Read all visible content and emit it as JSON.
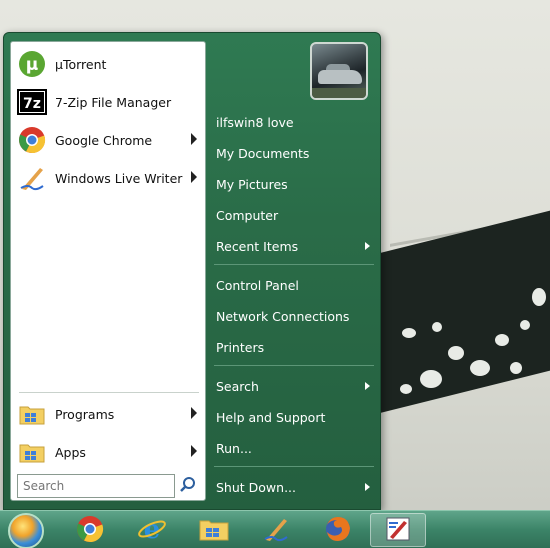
{
  "pinned": [
    {
      "label": "µTorrent",
      "icon": "utorrent-icon",
      "arrow": false
    },
    {
      "label": "7-Zip File Manager",
      "icon": "7zip-icon",
      "arrow": false
    },
    {
      "label": "Google Chrome",
      "icon": "chrome-icon",
      "arrow": true
    },
    {
      "label": "Windows Live Writer",
      "icon": "live-writer-icon",
      "arrow": true
    }
  ],
  "bottom_left": [
    {
      "label": "Programs",
      "icon": "programs-folder-icon",
      "arrow": true
    },
    {
      "label": "Apps",
      "icon": "apps-folder-icon",
      "arrow": true
    }
  ],
  "search": {
    "placeholder": "Search"
  },
  "right_items": [
    {
      "label": "ilfswin8 love",
      "arrow": false
    },
    {
      "label": "My Documents",
      "arrow": false
    },
    {
      "label": "My Pictures",
      "arrow": false
    },
    {
      "label": "Computer",
      "arrow": false
    },
    {
      "label": "Recent Items",
      "arrow": true
    },
    {
      "label": "Control Panel",
      "arrow": false
    },
    {
      "label": "Network Connections",
      "arrow": false
    },
    {
      "label": "Printers",
      "arrow": false
    },
    {
      "label": "Search",
      "arrow": true
    },
    {
      "label": "Help and Support",
      "arrow": false
    },
    {
      "label": "Run...",
      "arrow": false
    },
    {
      "label": "Shut Down...",
      "arrow": true
    }
  ],
  "taskbar": [
    {
      "icon": "chrome-icon"
    },
    {
      "icon": "internet-explorer-icon"
    },
    {
      "icon": "file-explorer-icon"
    },
    {
      "icon": "live-writer-icon"
    },
    {
      "icon": "firefox-icon"
    },
    {
      "icon": "paint-app-icon",
      "active": true
    }
  ],
  "colors": {
    "menu_green": "#2a6c48",
    "taskbar_green": "#3c8468"
  }
}
